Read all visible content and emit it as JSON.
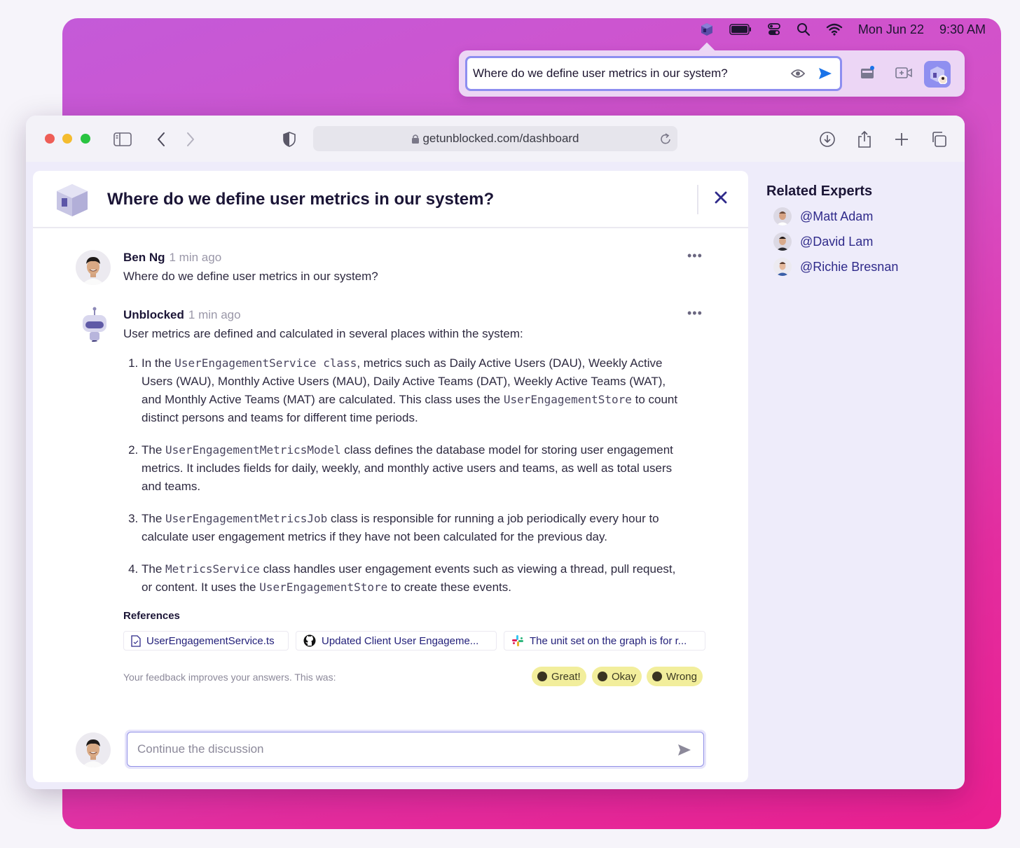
{
  "menubar": {
    "date": "Mon Jun 22",
    "time": "9:30 AM",
    "icons": [
      "unblocked-app-icon",
      "battery-icon",
      "control-center-icon",
      "search-icon",
      "wifi-icon"
    ]
  },
  "popover": {
    "query": "Where do we define user metrics in our system?"
  },
  "browser": {
    "url": "getunblocked.com/dashboard"
  },
  "thread": {
    "title": "Where do we define user metrics in our system?",
    "messages": [
      {
        "author": "Ben Ng",
        "time": "1 min ago",
        "text": "Where do we define user metrics in our system?"
      },
      {
        "author": "Unblocked",
        "time": "1 min ago",
        "intro": "User metrics are defined and calculated in several places within the system:",
        "items": [
          {
            "t1": "In the ",
            "c1": "UserEngagementService class",
            "t2": ", metrics such as Daily Active Users (DAU), Weekly Active Users (WAU), Monthly Active Users (MAU), Daily Active Teams (DAT), Weekly Active Teams (WAT), and Monthly Active Teams (MAT) are calculated. This class uses the ",
            "c2": "UserEngagementStore",
            "t3": " to count distinct persons and teams for different time periods."
          },
          {
            "t1": "The ",
            "c1": "UserEngagementMetricsModel",
            "t2": " class defines the database model for storing user engagement metrics. It includes fields for daily, weekly, and monthly active users and teams, as well as total users and teams.",
            "c2": "",
            "t3": ""
          },
          {
            "t1": "The ",
            "c1": "UserEngagementMetricsJob",
            "t2": " class is responsible for running a job periodically every hour to calculate user engagement metrics if they have not been calculated for the previous day.",
            "c2": "",
            "t3": ""
          },
          {
            "t1": "The ",
            "c1": "MetricsService",
            "t2": " class handles user engagement events such as viewing a thread, pull request, or content. It uses the ",
            "c2": "UserEngagementStore",
            "t3": " to create these events."
          }
        ]
      }
    ],
    "references_title": "References",
    "references": [
      {
        "label": "UserEngagementService.ts",
        "icon": "file-icon"
      },
      {
        "label": "Updated Client User Engageme...",
        "icon": "github-icon"
      },
      {
        "label": "The unit set on the graph is for r...",
        "icon": "slack-icon"
      }
    ],
    "feedback_prompt": "Your feedback improves your answers. This was:",
    "feedback": [
      "Great!",
      "Okay",
      "Wrong"
    ],
    "reply_placeholder": "Continue the discussion"
  },
  "experts": {
    "title": "Related Experts",
    "list": [
      "@Matt Adam",
      "@David Lam",
      "@Richie Bresnan"
    ]
  },
  "colors": {
    "accent": "#2f2a8a",
    "send_blue": "#1a73e8",
    "feedback_bg": "#f2ee9c",
    "traffic_red": "#ee5e57",
    "traffic_yellow": "#f4bc2f",
    "traffic_green": "#29c441"
  }
}
